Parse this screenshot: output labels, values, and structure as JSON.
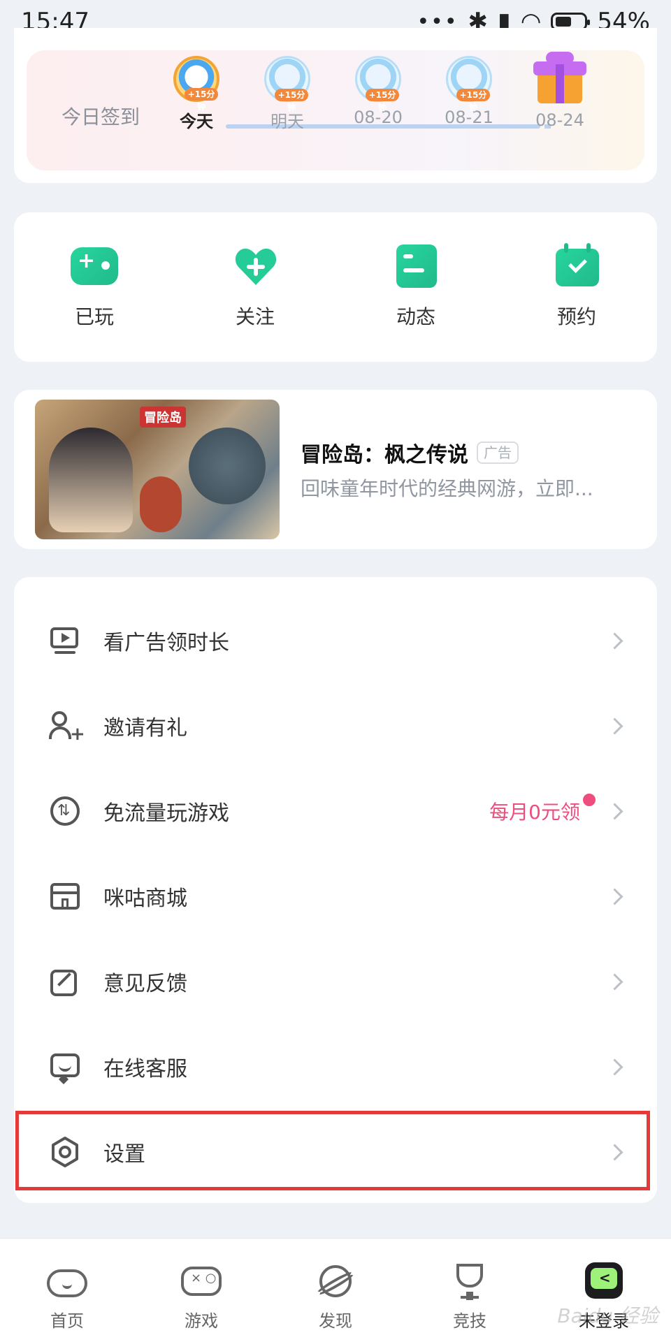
{
  "status_bar": {
    "time": "15:47",
    "battery": "54%"
  },
  "signin": {
    "label": "今日签到",
    "days": [
      {
        "label": "今天",
        "reward": "+15分钟",
        "active": true
      },
      {
        "label": "明天",
        "reward": "+15分钟"
      },
      {
        "label": "08-20",
        "reward": "+15分钟"
      },
      {
        "label": "08-21",
        "reward": "+15分钟"
      },
      {
        "label": "08-24",
        "reward": "gift"
      }
    ]
  },
  "quick_actions": [
    {
      "label": "已玩",
      "icon": "gamepad-icon"
    },
    {
      "label": "关注",
      "icon": "heart-plus-icon"
    },
    {
      "label": "动态",
      "icon": "news-icon"
    },
    {
      "label": "预约",
      "icon": "calendar-check-icon"
    }
  ],
  "ad": {
    "title": "冒险岛：枫之传说",
    "badge": "广告",
    "description": "回味童年时代的经典网游，立即...",
    "image_logo": "冒险岛"
  },
  "menu": {
    "items": [
      {
        "label": "看广告领时长",
        "icon": "tv-play-icon"
      },
      {
        "label": "邀请有礼",
        "icon": "user-add-icon"
      },
      {
        "label": "免流量玩游戏",
        "icon": "data-free-icon",
        "extra": "每月0元领"
      },
      {
        "label": "咪咕商城",
        "icon": "store-icon"
      },
      {
        "label": "意见反馈",
        "icon": "edit-icon"
      },
      {
        "label": "在线客服",
        "icon": "chat-icon"
      },
      {
        "label": "设置",
        "icon": "settings-hex-icon"
      }
    ]
  },
  "bottom_nav": [
    {
      "label": "首页",
      "icon": "home-cloud-icon"
    },
    {
      "label": "游戏",
      "icon": "gamepad-outline-icon"
    },
    {
      "label": "发现",
      "icon": "planet-icon"
    },
    {
      "label": "竞技",
      "icon": "trophy-icon"
    },
    {
      "label": "未登录",
      "icon": "avatar-icon"
    }
  ],
  "watermark": "Baidu 经验"
}
